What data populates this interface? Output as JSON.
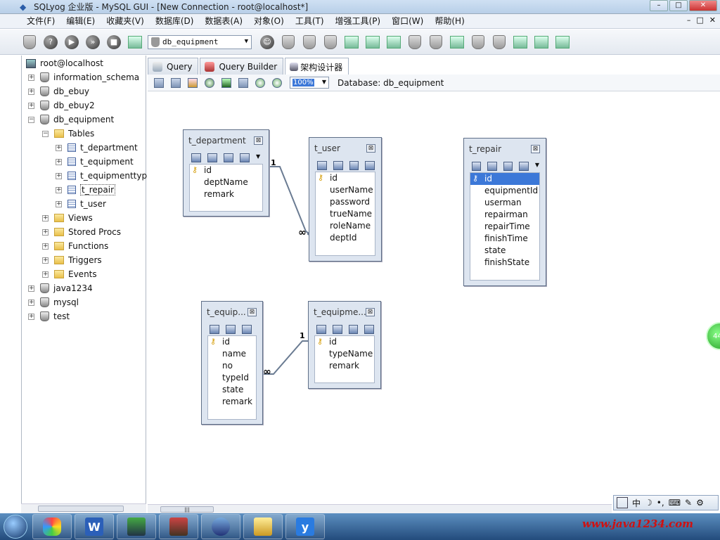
{
  "window": {
    "title": "SQLyog 企业版 - MySQL GUI - [New Connection - root@localhost*]",
    "minimize": "–",
    "maximize": "□",
    "close": "✕"
  },
  "menu": [
    "文件(F)",
    "编辑(E)",
    "收藏夹(V)",
    "数据库(D)",
    "数据表(A)",
    "对象(O)",
    "工具(T)",
    "增强工具(P)",
    "窗口(W)",
    "帮助(H)"
  ],
  "mdi_buttons": [
    "–",
    "□",
    "✕"
  ],
  "toolbar": {
    "database_selector": "db_equipment"
  },
  "tree": {
    "root": "root@localhost",
    "databases": [
      "information_schema",
      "db_ebuy",
      "db_ebuy2",
      "db_equipment",
      "java1234",
      "mysql",
      "test"
    ],
    "expanded_db": "db_equipment",
    "groups": [
      "Tables",
      "Views",
      "Stored Procs",
      "Functions",
      "Triggers",
      "Events"
    ],
    "tables": [
      "t_department",
      "t_equipment",
      "t_equipmenttyp",
      "t_repair",
      "t_user"
    ],
    "selected_table": "t_repair",
    "expand_plus": "+",
    "expand_minus": "−"
  },
  "tabs": [
    {
      "label": "Query"
    },
    {
      "label": "Query Builder"
    },
    {
      "label": "架构设计器"
    }
  ],
  "active_tab": "架构设计器",
  "designer": {
    "zoom": "100%",
    "database_label": "Database: db_equipment"
  },
  "schema_tables": [
    {
      "name": "t_department",
      "columns": [
        "id",
        "deptName",
        "remark"
      ],
      "pk": "id"
    },
    {
      "name": "t_user",
      "columns": [
        "id",
        "userName",
        "password",
        "trueName",
        "roleName",
        "deptId"
      ],
      "pk": "id"
    },
    {
      "name": "t_repair",
      "columns": [
        "id",
        "equipmentId",
        "userman",
        "repairman",
        "repairTime",
        "finishTime",
        "state",
        "finishState"
      ],
      "pk": "id",
      "selected": "id"
    },
    {
      "name": "t_equip...",
      "columns": [
        "id",
        "name",
        "no",
        "typeId",
        "state",
        "remark"
      ],
      "pk": "id"
    },
    {
      "name": "t_equipme...",
      "columns": [
        "id",
        "typeName",
        "remark"
      ],
      "pk": "id"
    }
  ],
  "relations": [
    {
      "from": "t_department",
      "to": "t_user",
      "from_card": "1",
      "to_card": "∞"
    },
    {
      "from": "t_equipme...",
      "to": "t_equip...",
      "from_card": "1",
      "to_card": "∞"
    }
  ],
  "close_glyph": "⊠",
  "green_badge": "44",
  "ime_bar": [
    "中",
    "☽",
    "•,",
    "⌨",
    "✎",
    "⚙"
  ],
  "taskbar_items": [
    "W",
    "",
    "",
    "",
    "",
    "y"
  ],
  "watermark": "www.java1234.com"
}
